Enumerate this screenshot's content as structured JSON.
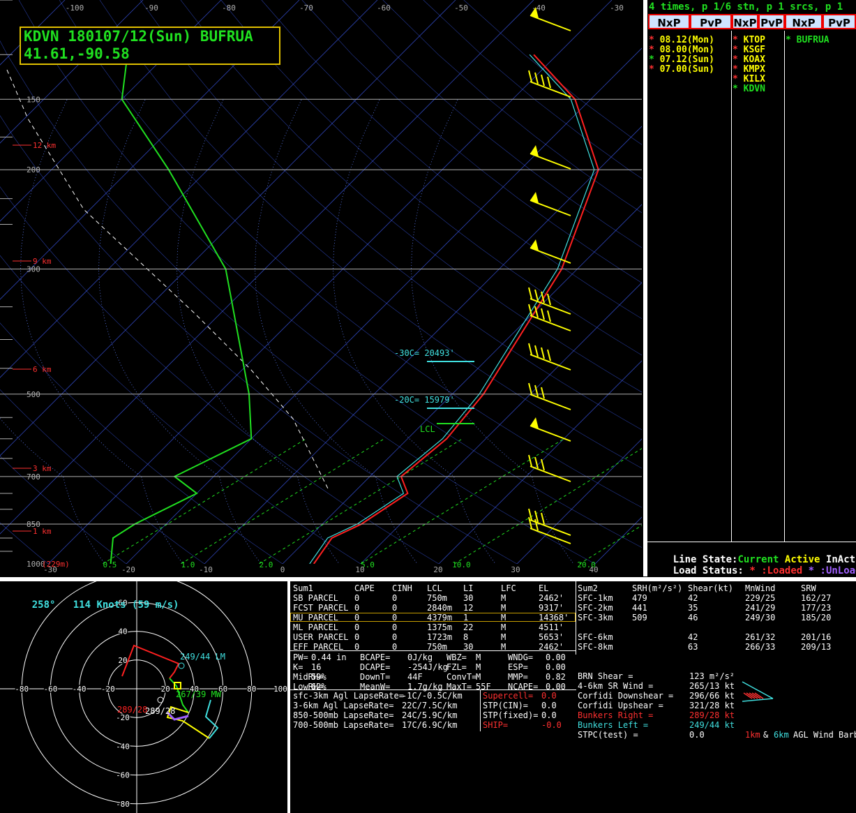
{
  "station_box": {
    "line1": "KDVN 180107/12(Sun) BUFRUA",
    "line2": "41.61,-90.58"
  },
  "colors": {
    "temp": "#ff2020",
    "dew": "#20e020",
    "virt": "#40e0e0",
    "barb": "#ffff00",
    "iso": "#4060ff",
    "grid": "#b0b0b0",
    "accent": "#ff3030"
  },
  "skewt": {
    "pressure_labels": [
      "150",
      "200",
      "300",
      "500",
      "700",
      "850",
      "1000"
    ],
    "height_labels": [
      "12 km",
      "9 km",
      "6 km",
      "3 km",
      "1 km"
    ],
    "sfc_label": "(229m)",
    "top_temps": [
      "-100",
      "-90",
      "-80",
      "-70",
      "-60",
      "-50",
      "-40",
      "-30"
    ],
    "bottom_temps": [
      "-30",
      "-20",
      "-10",
      "0",
      "10",
      "20",
      "30",
      "40"
    ],
    "mixing_ratios": [
      "0.5",
      "1.0",
      "2.0",
      "5.0",
      "10.0",
      "20.0"
    ],
    "annotations": {
      "c30": "-30C= 20493'",
      "c20": "-20C= 15979'",
      "lcl": "LCL"
    }
  },
  "right_panel": {
    "header": "4 times, p 1/6 stn, p 1 srcs, p 1",
    "buttons": [
      "NxP",
      "PvP",
      "NxP",
      "PvP",
      "NxP",
      "PvP"
    ],
    "times": [
      {
        "star": "*",
        "text": "08.12(Mon)",
        "star_color": "#ff3030",
        "color": "#ffff00"
      },
      {
        "star": "*",
        "text": "08.00(Mon)",
        "star_color": "#ff3030",
        "color": "#ffff00"
      },
      {
        "star": "*",
        "text": "07.12(Sun)",
        "star_color": "#20e020",
        "color": "#ffff00"
      },
      {
        "star": "*",
        "text": "07.00(Sun)",
        "star_color": "#ff3030",
        "color": "#ffff00"
      }
    ],
    "stations": [
      {
        "star": "*",
        "text": "KTOP",
        "star_color": "#ff3030",
        "color": "#ffff00"
      },
      {
        "star": "*",
        "text": "KSGF",
        "star_color": "#ff3030",
        "color": "#ffff00"
      },
      {
        "star": "*",
        "text": "KOAX",
        "star_color": "#ff3030",
        "color": "#ffff00"
      },
      {
        "star": "*",
        "text": "KMPX",
        "star_color": "#ff3030",
        "color": "#ffff00"
      },
      {
        "star": "*",
        "text": "KILX",
        "star_color": "#ff3030",
        "color": "#ffff00"
      },
      {
        "star": "*",
        "text": "KDVN",
        "star_color": "#20e020",
        "color": "#20e020"
      }
    ],
    "sources": [
      {
        "star": "*",
        "text": "BUFRUA"
      }
    ],
    "line_state": {
      "label": "Line State:",
      "current": "Current",
      "active": "Active",
      "inactive": "InActive"
    },
    "load_status": {
      "label": "Load Status:",
      "star1": "*",
      "loaded": ":Loaded",
      "star2": "*",
      "unloaded": ":UnLoaded"
    }
  },
  "hodograph": {
    "header_dir": "258°",
    "header_speed": "114 Knots (59 m/s)",
    "ring_labels": [
      "20",
      "40",
      "60",
      "80"
    ],
    "x_labels": [
      "-80",
      "-60",
      "-40",
      "-20",
      "20",
      "40",
      "60",
      "80",
      "100"
    ],
    "y_labels": [
      "60",
      "40",
      "20",
      "-20",
      "-40",
      "-60",
      "-80"
    ],
    "lm_label": "249/44 LM",
    "mw_label": "267/39 MW",
    "rm_label_red": "289/28",
    "rm_label_white": "289/28"
  },
  "sum1": {
    "header": [
      "Sum1",
      "CAPE",
      "CINH",
      "LCL",
      "LI",
      "LFC",
      "EL"
    ],
    "rows": [
      [
        "SB PARCEL",
        "0",
        "0",
        "750m",
        "30",
        "M",
        "2462'"
      ],
      [
        "FCST PARCEL",
        "0",
        "0",
        "2840m",
        "12",
        "M",
        "9317'"
      ],
      [
        "MU PARCEL",
        "0",
        "0",
        "4379m",
        "1",
        "M",
        "14368'"
      ],
      [
        "ML PARCEL",
        "0",
        "0",
        "1375m",
        "22",
        "M",
        "4511'"
      ],
      [
        "USER PARCEL",
        "0",
        "0",
        "1723m",
        "8",
        "M",
        "5653'"
      ],
      [
        "EFF PARCEL",
        "0",
        "0",
        "750m",
        "30",
        "M",
        "2462'"
      ]
    ],
    "params": [
      [
        "PW=",
        "0.44 in",
        "BCAPE=",
        "0J/kg",
        "WBZ=",
        "M",
        "WNDG=",
        "0.00"
      ],
      [
        "K=",
        "16",
        "DCAPE=",
        "-254J/kg",
        "FZL=",
        "M",
        "ESP=",
        "0.00"
      ],
      [
        "MidRH=",
        "59%",
        "DownT=",
        "44F",
        "ConvT=",
        "M",
        "MMP=",
        "0.82"
      ],
      [
        "LowRH=",
        "62%",
        "MeanW=",
        "1.7g/kg",
        "MaxT=",
        "55F",
        "NCAPE=",
        "0.00"
      ]
    ],
    "lapse": [
      [
        "sfc-3km Agl LapseRate=",
        "-1C/-0.5C/km"
      ],
      [
        "3-6km Agl LapseRate=",
        "22C/7.5C/km"
      ],
      [
        "850-500mb LapseRate=",
        "24C/5.9C/km"
      ],
      [
        "700-500mb LapseRate=",
        "17C/6.9C/km"
      ]
    ],
    "indices": [
      {
        "label": "Supercell=",
        "value": "0.0",
        "color": "#ff3030"
      },
      {
        "label": "STP(CIN)=",
        "value": "0.0",
        "color": "#ffffff"
      },
      {
        "label": "STP(fixed)=",
        "value": "0.0",
        "color": "#ffffff"
      },
      {
        "label": "SHIP=",
        "value": "-0.0",
        "color": "#ff3030"
      }
    ]
  },
  "sum2": {
    "header": [
      "Sum2",
      "SRH(m²/s²)",
      "Shear(kt)",
      "MnWind",
      "SRW"
    ],
    "rows": [
      [
        "SFC-1km",
        "479",
        "42",
        "229/25",
        "162/27"
      ],
      [
        "SFC-2km",
        "441",
        "35",
        "241/29",
        "177/23"
      ],
      [
        "SFC-3km",
        "509",
        "46",
        "249/30",
        "185/20"
      ],
      [
        "SFC-6km",
        "",
        "42",
        "261/32",
        "201/16"
      ],
      [
        "SFC-8km",
        "",
        "63",
        "266/33",
        "209/13"
      ]
    ],
    "params": [
      {
        "label": "BRN Shear =",
        "value": "123 m²/s²",
        "lc": "#ffffff",
        "vc": "#ffffff"
      },
      {
        "label": "4-6km SR Wind =",
        "value": "265/13 kt",
        "lc": "#ffffff",
        "vc": "#ffffff"
      },
      {
        "label": "Corfidi Downshear =",
        "value": "296/66 kt",
        "lc": "#ffffff",
        "vc": "#ffffff"
      },
      {
        "label": "Corfidi Upshear =",
        "value": "321/28 kt",
        "lc": "#ffffff",
        "vc": "#ffffff"
      },
      {
        "label": "Bunkers Right =",
        "value": "289/28 kt",
        "lc": "#ff3030",
        "vc": "#ff3030"
      },
      {
        "label": "Bunkers Left =",
        "value": "249/44 kt",
        "lc": "#40e0e0",
        "vc": "#40e0e0"
      },
      {
        "label": "STPC(test) =",
        "value": "0.0",
        "lc": "#ffffff",
        "vc": "#ffffff"
      }
    ],
    "legend": {
      "a": "1km",
      "amp": "&",
      "b": "6km",
      "c": "AGL Wind Barb"
    }
  },
  "chart_data": {
    "type": "line",
    "title": "KDVN 180107/12(Sun) BUFRUA",
    "xlabel": "",
    "ylabel": "",
    "series": [
      {
        "name": "",
        "x": [
          -33,
          -22,
          -10,
          -2,
          4,
          5,
          4,
          7,
          5,
          3,
          4
        ],
        "y": [
          125,
          150,
          200,
          300,
          500,
          600,
          700,
          750,
          850,
          900,
          1000
        ]
      },
      {
        "name": "",
        "x": [
          -85,
          -80,
          -65,
          -45,
          -26,
          -20,
          -25,
          -20,
          -24,
          -25,
          -22
        ],
        "y": [
          125,
          150,
          200,
          300,
          500,
          600,
          700,
          750,
          850,
          900,
          1000
        ]
      }
    ],
    "wind_profile": {
      "surface_dir_deg": 258,
      "surface_speed_kt": 114
    }
  }
}
